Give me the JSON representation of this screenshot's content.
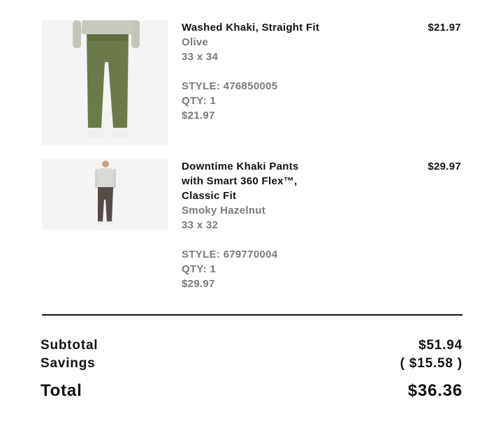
{
  "items": [
    {
      "name": "Washed Khaki, Straight Fit",
      "color": "Olive",
      "size": "33 x 34",
      "style": "STYLE: 476850005",
      "qty": "QTY: 1",
      "unit_price": "$21.97",
      "line_price": "$21.97"
    },
    {
      "name": "Downtime Khaki Pants with Smart 360 Flex™, Classic Fit",
      "color": "Smoky Hazelnut",
      "size": "33 x 32",
      "style": "STYLE: 679770004",
      "qty": "QTY: 1",
      "unit_price": "$29.97",
      "line_price": "$29.97"
    }
  ],
  "summary": {
    "subtotal_label": "Subtotal",
    "subtotal_value": "$51.94",
    "savings_label": "Savings",
    "savings_value": "( $15.58 )",
    "total_label": "Total",
    "total_value": "$36.36"
  }
}
